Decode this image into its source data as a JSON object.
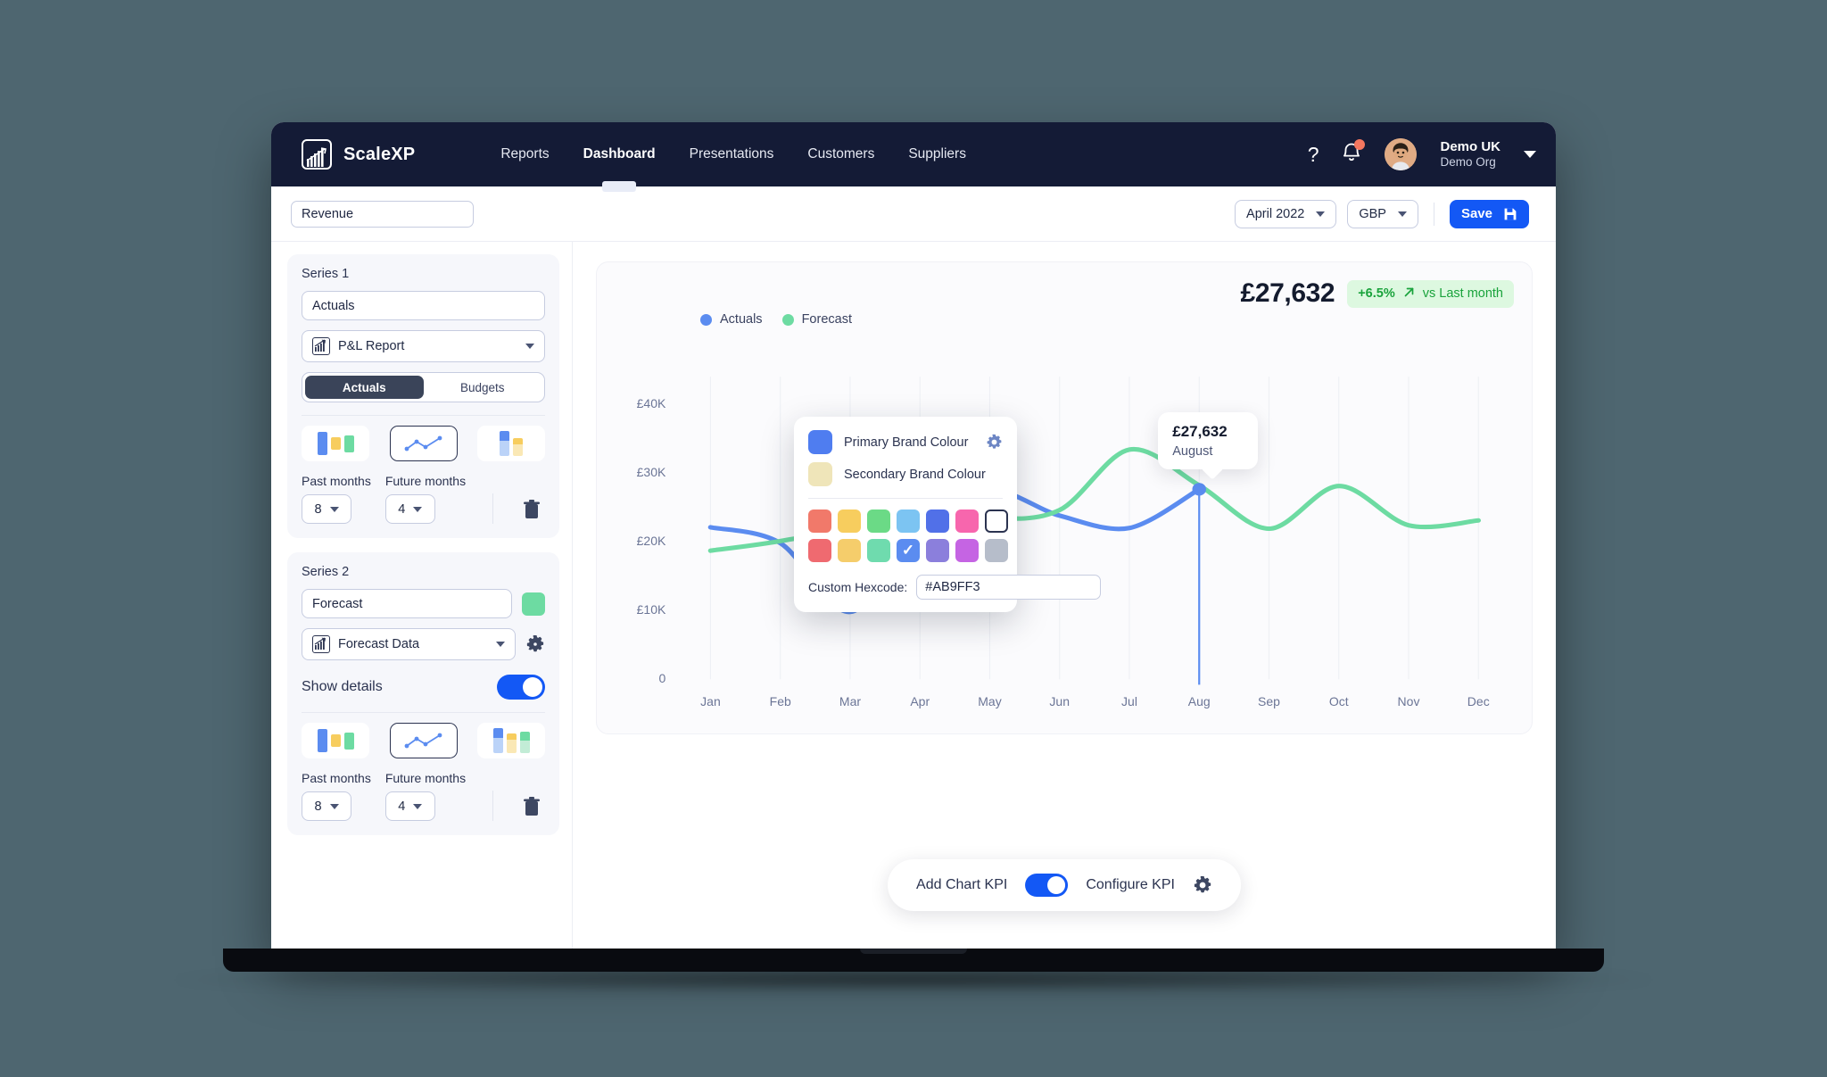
{
  "brand": {
    "name": "ScaleXP",
    "logo_icon": "bar-chart-logo-icon"
  },
  "nav": {
    "links": [
      {
        "label": "Reports",
        "active": false
      },
      {
        "label": "Dashboard",
        "active": true
      },
      {
        "label": "Presentations",
        "active": false
      },
      {
        "label": "Customers",
        "active": false
      },
      {
        "label": "Suppliers",
        "active": false
      }
    ],
    "help_icon": "question-mark-icon",
    "bell_icon": "notification-bell-icon",
    "avatar_icon": "user-avatar",
    "user_name": "Demo UK",
    "user_org": "Demo Org",
    "caret_icon": "chevron-down-icon"
  },
  "toolbar": {
    "title_value": "Revenue",
    "title_placeholder": "Chart name",
    "period": "April 2022",
    "currency": "GBP",
    "save_label": "Save",
    "save_icon": "floppy-disk-icon"
  },
  "sidebar": {
    "series": [
      {
        "heading": "Series 1",
        "name_value": "Actuals",
        "name_placeholder": "Series name",
        "source_label": "P&L Report",
        "source_icon": "report-chart-icon",
        "segments": [
          {
            "label": "Actuals",
            "active": true
          },
          {
            "label": "Budgets",
            "active": false
          }
        ],
        "chart_types": [
          {
            "icon": "bar-chart-icon",
            "selected": false
          },
          {
            "icon": "line-chart-icon",
            "selected": true
          },
          {
            "icon": "stacked-bar-chart-icon",
            "selected": false
          }
        ],
        "past_months_label": "Past months",
        "past_months_value": "8",
        "future_months_label": "Future months",
        "future_months_value": "4",
        "delete_icon": "trash-icon",
        "swatch_color": "#4f7df0",
        "has_swatch": false,
        "has_gear": false,
        "show_details": null
      },
      {
        "heading": "Series 2",
        "name_value": "Forecast",
        "name_placeholder": "Series name",
        "source_label": "Forecast Data",
        "source_icon": "report-chart-icon",
        "segments": [],
        "chart_types": [
          {
            "icon": "bar-chart-icon",
            "selected": false
          },
          {
            "icon": "line-chart-icon",
            "selected": true
          },
          {
            "icon": "stacked-bar-chart-icon",
            "selected": false
          }
        ],
        "past_months_label": "Past months",
        "past_months_value": "8",
        "future_months_label": "Future months",
        "future_months_value": "4",
        "delete_icon": "trash-icon",
        "swatch_color": "#6ddba2",
        "has_swatch": true,
        "has_gear": true,
        "show_details": {
          "label": "Show details",
          "on": true
        }
      }
    ]
  },
  "colour_picker": {
    "primary_label": "Primary Brand Colour",
    "primary_color": "#4f7df0",
    "secondary_label": "Secondary Brand Colour",
    "secondary_color": "#efe5b9",
    "gear_icon": "gear-icon",
    "swatches_row1": [
      "#f1796a",
      "#f7cd5e",
      "#6bda86",
      "#7cc4f2",
      "#5170e8",
      "#f766ad",
      "#ffffff"
    ],
    "swatches_row2": [
      "#ef6a70",
      "#f5cd6b",
      "#6fdbae",
      "#5b8cf0",
      "#8b7fdc",
      "#c564e3",
      "#b6bdca"
    ],
    "selected_index": 3,
    "selected_row": 2,
    "check_icon": "check-icon",
    "hex_label": "Custom Hexcode:",
    "hex_value": "#AB9FF3",
    "hex_preview_color": "#eceaf8"
  },
  "chart_panel": {
    "legend": [
      {
        "label": "Actuals",
        "color": "#5b8cf0"
      },
      {
        "label": "Forecast",
        "color": "#6ddba2"
      }
    ],
    "kpi_value": "£27,632",
    "kpi_delta": "+6.5%",
    "kpi_arrow": "arrow-up-right-icon",
    "kpi_comparison": "vs Last month",
    "tooltip": {
      "value": "£27,632",
      "label": "August"
    },
    "kpi_bar": {
      "add_label": "Add Chart KPI",
      "add_on": true,
      "configure_label": "Configure KPI",
      "configure_icon": "gear-icon"
    }
  },
  "chart_data": {
    "type": "line",
    "title": "Revenue",
    "xlabel": "",
    "ylabel": "",
    "categories": [
      "Jan",
      "Feb",
      "Mar",
      "Apr",
      "May",
      "Jun",
      "Jul",
      "Aug",
      "Sep",
      "Oct",
      "Nov",
      "Dec"
    ],
    "ytick_labels": [
      "0",
      "£10K",
      "£20K",
      "£30K",
      "£40K"
    ],
    "ytick_values": [
      0,
      10000,
      20000,
      30000,
      40000
    ],
    "ylim": [
      0,
      44000
    ],
    "grid": "vertical",
    "legend_position": "top-left",
    "currency_symbol": "£",
    "highlight": {
      "category": "Aug",
      "series": "Actuals",
      "value": 27632
    },
    "series": [
      {
        "name": "Actuals",
        "color": "#5b8cf0",
        "values": [
          22100,
          19800,
          9800,
          21600,
          27400,
          23800,
          22000,
          27632,
          null,
          null,
          null,
          null
        ]
      },
      {
        "name": "Forecast",
        "color": "#6ddba2",
        "values": [
          18700,
          20100,
          22300,
          27500,
          23700,
          24600,
          33400,
          28200,
          21900,
          28100,
          22400,
          23100
        ]
      }
    ]
  }
}
